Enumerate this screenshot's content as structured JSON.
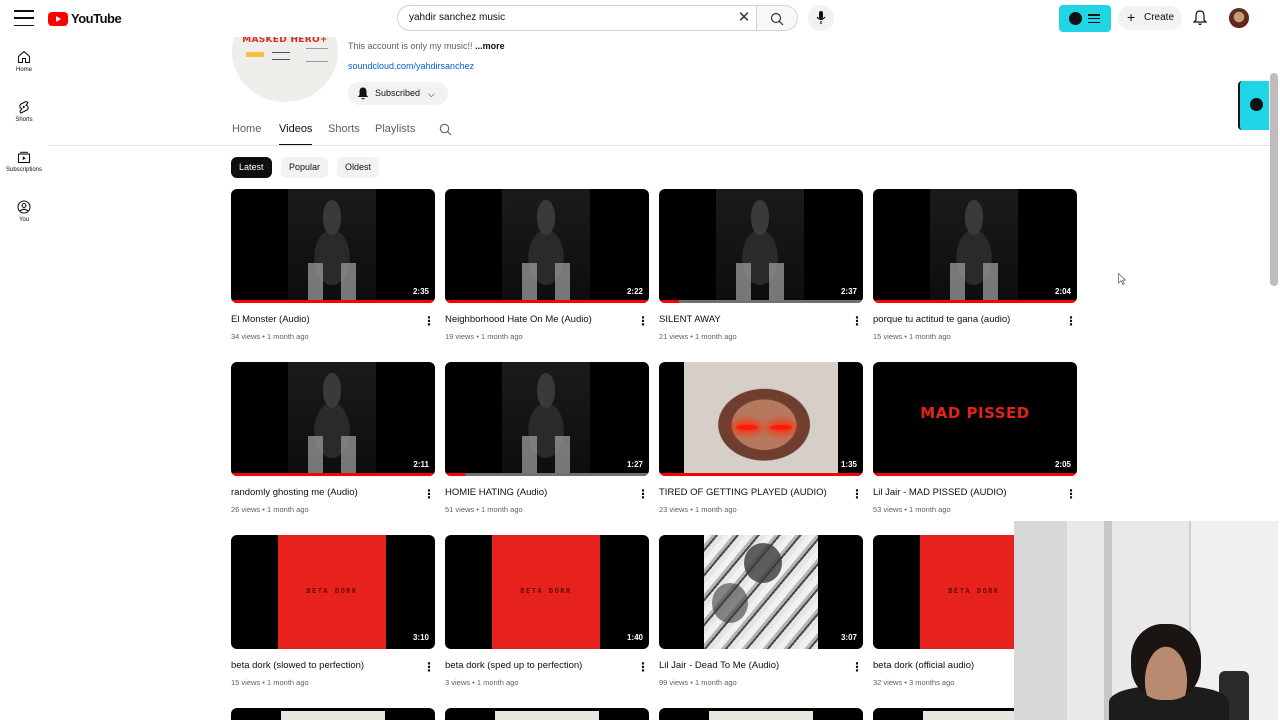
{
  "header": {
    "logo_text": "YouTube",
    "search_value": "yahdir sanchez music",
    "create_label": "Create"
  },
  "rail": [
    {
      "label": "Home",
      "icon": "home-icon"
    },
    {
      "label": "Shorts",
      "icon": "shorts-icon"
    },
    {
      "label": "Subscriptions",
      "icon": "subscriptions-icon"
    },
    {
      "label": "You",
      "icon": "you-icon"
    }
  ],
  "channel": {
    "avatar_text": "MASKED HERO+",
    "description": "This account is only my music!!",
    "more_label": "...more",
    "link": "soundcloud.com/yahdirsanchez",
    "subscribe_label": "Subscribed"
  },
  "tabs": [
    "Home",
    "Videos",
    "Shorts",
    "Playlists"
  ],
  "active_tab": "Videos",
  "chips": [
    "Latest",
    "Popular",
    "Oldest"
  ],
  "active_chip": "Latest",
  "videos": [
    {
      "title": "El Monster (Audio)",
      "views": "34 views",
      "age": "1 month ago",
      "duration": "2:35",
      "art": "person",
      "progress": 1.0
    },
    {
      "title": "Neighborhood Hate On Me (Audio)",
      "views": "19 views",
      "age": "1 month ago",
      "duration": "2:22",
      "art": "person",
      "progress": 1.0
    },
    {
      "title": "SILENT AWAY",
      "views": "21 views",
      "age": "1 month ago",
      "duration": "2:37",
      "art": "person",
      "progress": 0.1
    },
    {
      "title": "porque tu actitud te gana (audio)",
      "views": "15 views",
      "age": "1 month ago",
      "duration": "2:04",
      "art": "person",
      "progress": 1.0
    },
    {
      "title": "randomly ghosting me (Audio)",
      "views": "26 views",
      "age": "1 month ago",
      "duration": "2:11",
      "art": "person",
      "progress": 1.0
    },
    {
      "title": "HOMIE HATING (Audio)",
      "views": "51 views",
      "age": "1 month ago",
      "duration": "1:27",
      "art": "person",
      "progress": 0.1
    },
    {
      "title": "TIRED OF GETTING PLAYED (AUDIO)",
      "views": "23 views",
      "age": "1 month ago",
      "duration": "1:35",
      "art": "face",
      "progress": 1.0
    },
    {
      "title": "Lil Jair - MAD PISSED (AUDIO)",
      "views": "53 views",
      "age": "1 month ago",
      "duration": "2:05",
      "art": "mad",
      "art_text": "MAD PISSED",
      "progress": 1.0
    },
    {
      "title": "beta dork (slowed to perfection)",
      "views": "15 views",
      "age": "1 month ago",
      "duration": "3:10",
      "art": "red",
      "art_text": "BETA DORK",
      "progress": 0
    },
    {
      "title": "beta dork (sped up to perfection)",
      "views": "3 views",
      "age": "1 month ago",
      "duration": "1:40",
      "art": "red",
      "art_text": "BETA DORK",
      "progress": 0
    },
    {
      "title": "Lil Jair - Dead To Me (Audio)",
      "views": "99 views",
      "age": "1 month ago",
      "duration": "3:07",
      "art": "bw",
      "progress": 0
    },
    {
      "title": "beta dork (official audio)",
      "views": "32 views",
      "age": "3 months ago",
      "duration": "",
      "art": "red",
      "art_text": "BETA DORK",
      "progress": 0
    }
  ]
}
